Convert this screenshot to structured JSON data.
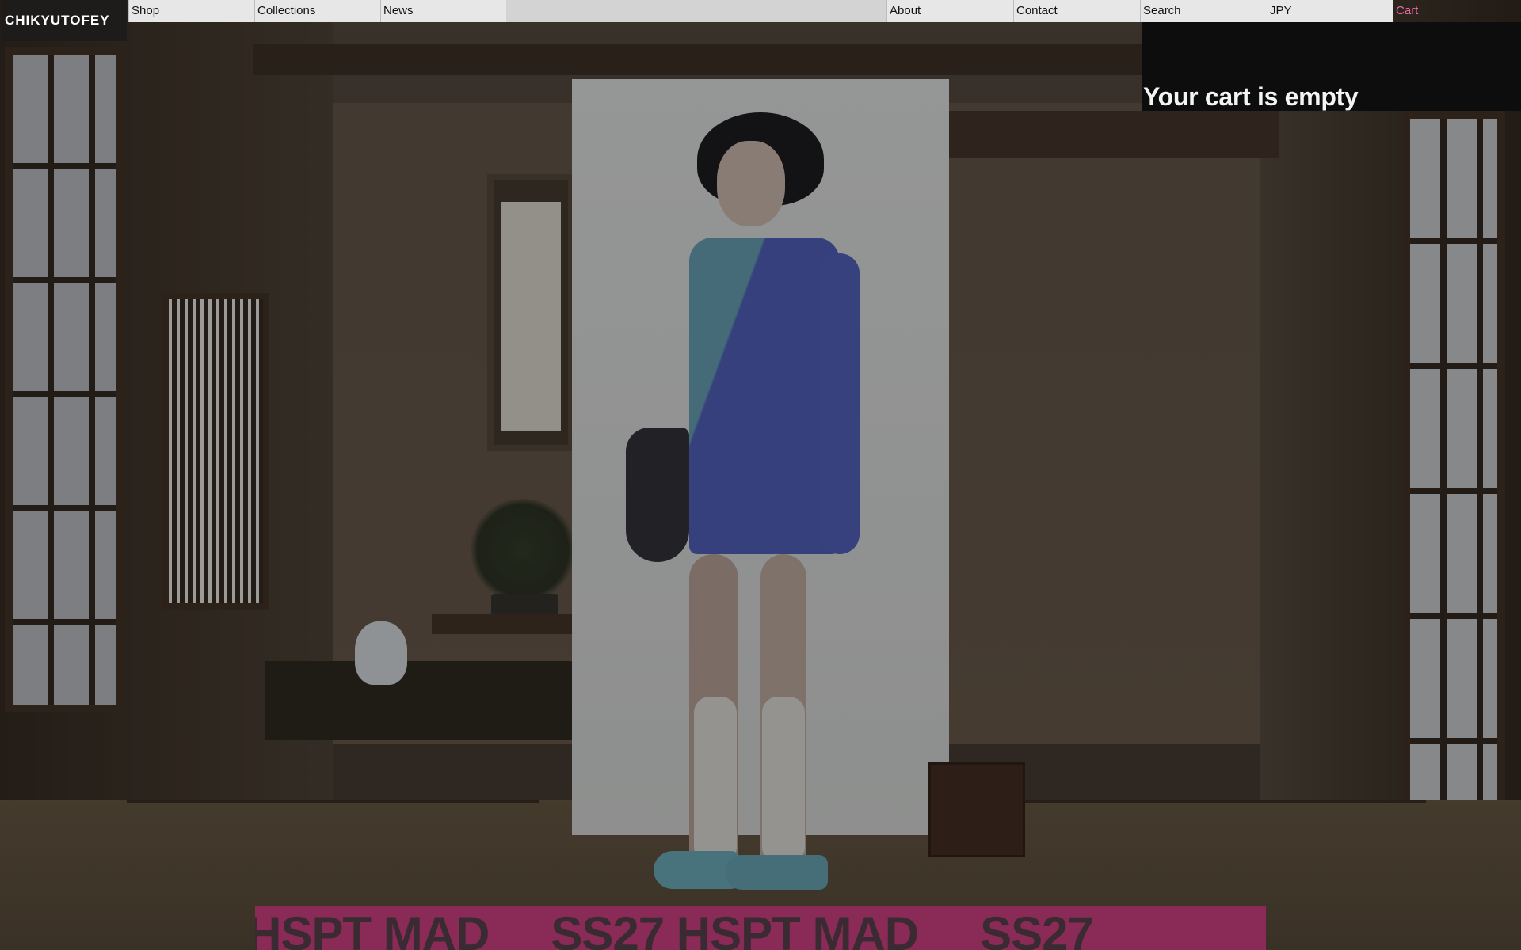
{
  "brand": {
    "name": "CHIKYUTOFEY"
  },
  "nav": {
    "shop": "Shop",
    "collections": "Collections",
    "news": "News",
    "about": "About",
    "contact": "Contact",
    "search": "Search",
    "currency": "JPY",
    "cart": "Cart"
  },
  "cart": {
    "empty_message": "Your cart is empty"
  },
  "banner": {
    "items": [
      "HSPT MAD",
      "SS27 HSPT MAD",
      "SS27"
    ]
  },
  "colors": {
    "accent": "#f06aa6",
    "banner": "#8a2a57",
    "nav_bg": "#e7e7e7",
    "cart_panel": "#0d0d0d"
  }
}
